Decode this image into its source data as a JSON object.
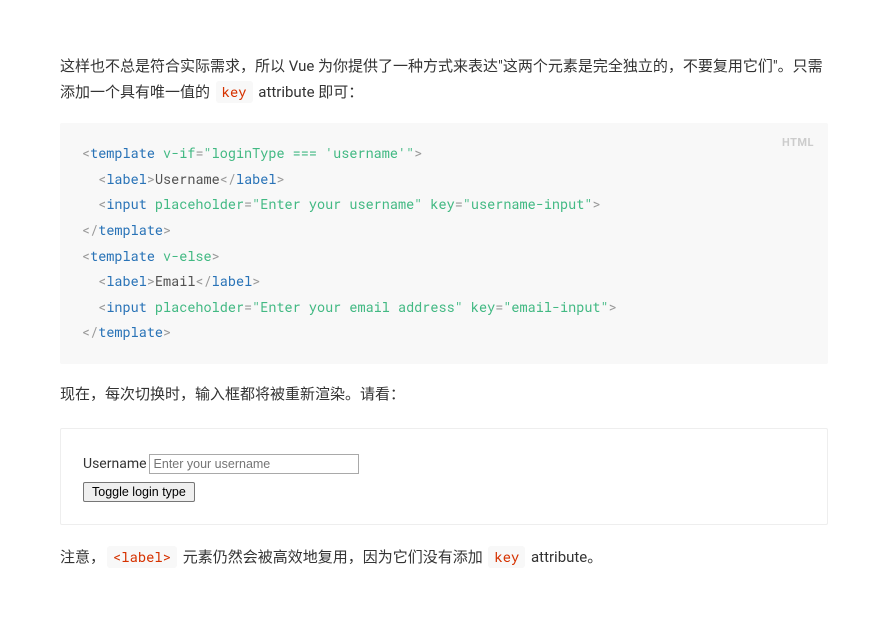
{
  "paragraphs": {
    "p1_a": "这样也不总是符合实际需求，所以 Vue 为你提供了一种方式来表达\"这两个元素是完全独立的，不要复用它们\"。只需添加一个具有唯一值的 ",
    "p1_code": "key",
    "p1_b": " attribute 即可：",
    "p2": "现在，每次切换时，输入框都将被重新渲染。请看：",
    "p3_a": "注意，",
    "p3_code1": "<label>",
    "p3_b": " 元素仍然会被高效地复用，因为它们没有添加 ",
    "p3_code2": "key",
    "p3_c": " attribute。"
  },
  "codeblock": {
    "lang": "HTML",
    "tokens": {
      "lt": "<",
      "gt": ">",
      "slash": "/",
      "eq": "=",
      "template": "template",
      "label": "label",
      "input": "input",
      "vif": " v-if",
      "velse": " v-else",
      "placeholder": " placeholder",
      "key": " key",
      "vif_val": "\"loginType === 'username'\"",
      "ph1": "\"Enter your username\"",
      "k1": "\"username-input\"",
      "ph2": "\"Enter your email address\"",
      "k2": "\"email-input\"",
      "txt_user": "Username",
      "txt_email": "Email"
    }
  },
  "demo": {
    "label": "Username",
    "placeholder": "Enter your username",
    "button": "Toggle login type"
  }
}
